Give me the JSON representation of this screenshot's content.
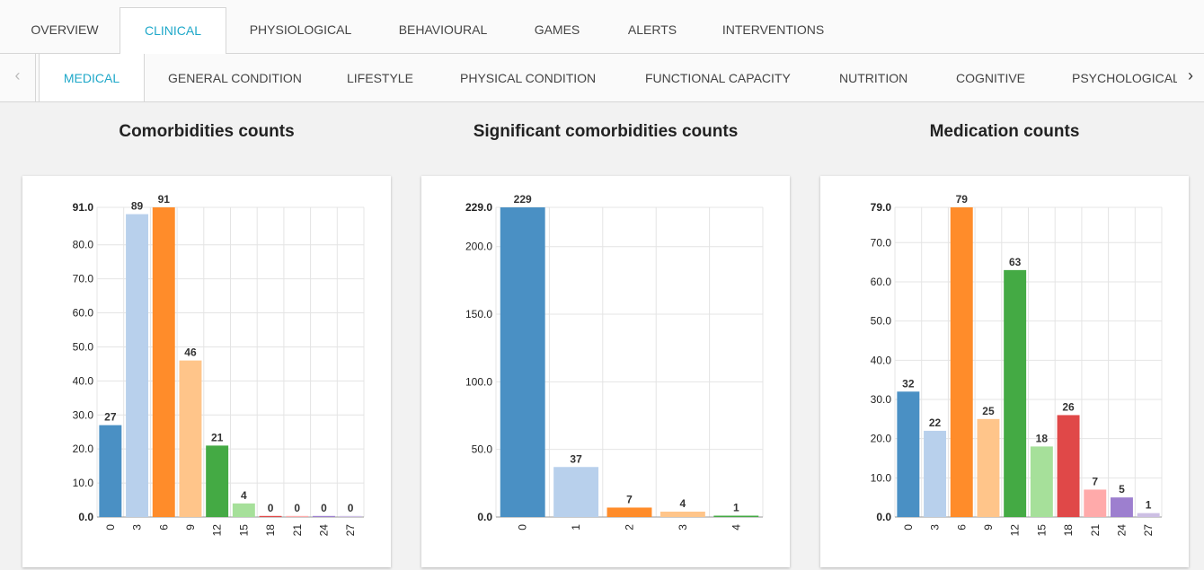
{
  "tabs_primary": [
    "OVERVIEW",
    "CLINICAL",
    "PHYSIOLOGICAL",
    "BEHAVIOURAL",
    "GAMES",
    "ALERTS",
    "INTERVENTIONS"
  ],
  "tabs_primary_active": "CLINICAL",
  "tabs_secondary": [
    "MEDICAL",
    "GENERAL CONDITION",
    "LIFESTYLE",
    "PHYSICAL CONDITION",
    "FUNCTIONAL CAPACITY",
    "NUTRITION",
    "COGNITIVE",
    "PSYCHOLOGICAL"
  ],
  "tabs_secondary_active": "MEDICAL",
  "arrows": {
    "left": "‹",
    "right": "›",
    "left_icon": "chevron-left-icon",
    "right_icon": "chevron-right-icon"
  },
  "accent_color": "#1fa8c9",
  "chart_data": [
    {
      "type": "bar",
      "title": "Comorbidities counts",
      "categories": [
        "0",
        "3",
        "6",
        "9",
        "12",
        "15",
        "18",
        "21",
        "24",
        "27"
      ],
      "values": [
        27,
        89,
        91,
        46,
        21,
        4,
        0,
        0,
        0,
        0
      ],
      "yticks": [
        "91.0",
        "80.0",
        "70.0",
        "60.0",
        "50.0",
        "40.0",
        "30.0",
        "20.0",
        "10.0",
        "0.0"
      ],
      "ylim": [
        0,
        91
      ],
      "colors": [
        "#4a90c4",
        "#b8d0ec",
        "#ff8c2a",
        "#ffc58a",
        "#44aa44",
        "#a6e09a",
        "#e04848",
        "#ffaaaa",
        "#9d7fcf",
        "#cdbfe4"
      ],
      "grid": true
    },
    {
      "type": "bar",
      "title": "Significant comorbidities counts",
      "categories": [
        "0",
        "1",
        "2",
        "3",
        "4"
      ],
      "values": [
        229,
        37,
        7,
        4,
        1
      ],
      "yticks": [
        "229.0",
        "200.0",
        "150.0",
        "100.0",
        "50.0",
        "0.0"
      ],
      "ylim": [
        0,
        229
      ],
      "colors": [
        "#4a90c4",
        "#b8d0ec",
        "#ff8c2a",
        "#ffc58a",
        "#44aa44"
      ],
      "grid": true
    },
    {
      "type": "bar",
      "title": "Medication counts",
      "categories": [
        "0",
        "3",
        "6",
        "9",
        "12",
        "15",
        "18",
        "21",
        "24",
        "27"
      ],
      "values": [
        32,
        22,
        79,
        25,
        63,
        18,
        26,
        7,
        5,
        1
      ],
      "yticks": [
        "79.0",
        "70.0",
        "60.0",
        "50.0",
        "40.0",
        "30.0",
        "20.0",
        "10.0",
        "0.0"
      ],
      "ylim": [
        0,
        79
      ],
      "colors": [
        "#4a90c4",
        "#b8d0ec",
        "#ff8c2a",
        "#ffc58a",
        "#44aa44",
        "#a6e09a",
        "#e04848",
        "#ffaaaa",
        "#9d7fcf",
        "#cdbfe4"
      ],
      "grid": true
    }
  ]
}
